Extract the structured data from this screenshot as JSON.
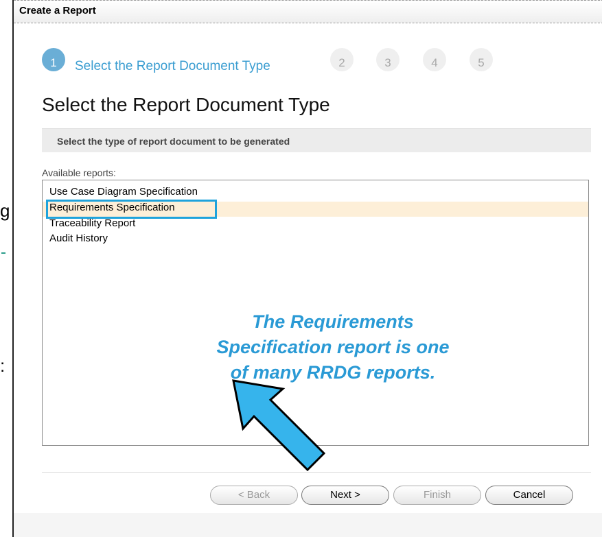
{
  "background": {
    "fragment_1": "g",
    "fragment_3": ":"
  },
  "dialog": {
    "title": "Create a Report"
  },
  "wizard": {
    "steps": [
      "1",
      "2",
      "3",
      "4",
      "5"
    ],
    "active_step_label": "Select the Report Document Type",
    "page_title": "Select the Report Document Type",
    "instruction": "Select the type of report document to be generated",
    "list_label": "Available reports:",
    "reports": [
      "Use Case Diagram Specification",
      "Requirements Specification",
      "Traceability Report",
      "Audit History"
    ],
    "selected_index": 1
  },
  "annotation": {
    "text_line1": "The Requirements",
    "text_line2": "Specification report is one",
    "text_line3": "of many RRDG reports.",
    "color": "#2a9ad5"
  },
  "buttons": {
    "back": "< Back",
    "next": "Next >",
    "finish": "Finish",
    "cancel": "Cancel"
  },
  "colors": {
    "accent": "#3a9dd1",
    "selection": "#fdefd8",
    "highlight_box": "#1fa3dc"
  }
}
